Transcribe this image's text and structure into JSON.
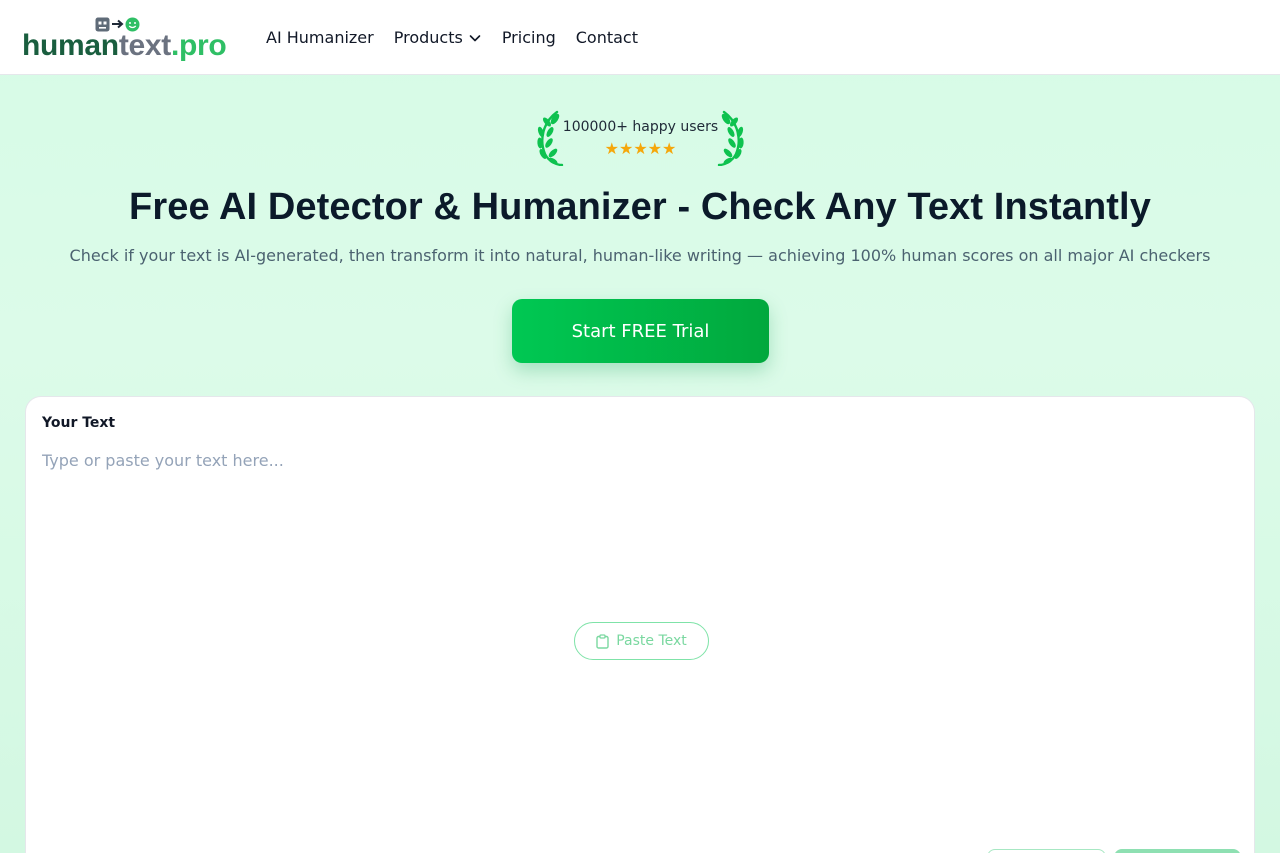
{
  "header": {
    "logo": {
      "part1": "human",
      "part2": "text",
      "part3": ".pro"
    },
    "nav": [
      {
        "label": "AI Humanizer"
      },
      {
        "label": "Products"
      },
      {
        "label": "Pricing"
      },
      {
        "label": "Contact"
      }
    ]
  },
  "hero": {
    "badge_text": "100000+ happy users",
    "stars": "★★★★★",
    "rating": 5,
    "title": "Free AI Detector & Humanizer - Check Any Text Instantly",
    "subtitle": "Check if your text is AI-generated, then transform it into natural, human-like writing — achieving 100% human scores on all major AI checkers",
    "cta_label": "Start FREE Trial"
  },
  "editor": {
    "label": "Your Text",
    "placeholder": "Type or paste your text here...",
    "paste_label": "Paste Text"
  },
  "colors": {
    "brand_green": "#00c853",
    "logo_dark": "#1a5e3f",
    "logo_accent": "#2fbf65",
    "star": "#f5a70b",
    "background": "#d6fbe6"
  }
}
